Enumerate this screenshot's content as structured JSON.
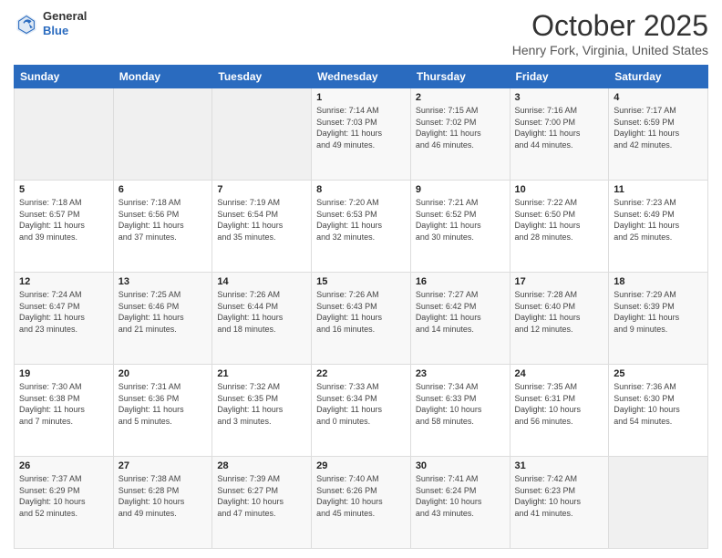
{
  "header": {
    "logo_line1": "General",
    "logo_line2": "Blue",
    "month": "October 2025",
    "location": "Henry Fork, Virginia, United States"
  },
  "days_of_week": [
    "Sunday",
    "Monday",
    "Tuesday",
    "Wednesday",
    "Thursday",
    "Friday",
    "Saturday"
  ],
  "weeks": [
    [
      {
        "day": "",
        "info": ""
      },
      {
        "day": "",
        "info": ""
      },
      {
        "day": "",
        "info": ""
      },
      {
        "day": "1",
        "info": "Sunrise: 7:14 AM\nSunset: 7:03 PM\nDaylight: 11 hours\nand 49 minutes."
      },
      {
        "day": "2",
        "info": "Sunrise: 7:15 AM\nSunset: 7:02 PM\nDaylight: 11 hours\nand 46 minutes."
      },
      {
        "day": "3",
        "info": "Sunrise: 7:16 AM\nSunset: 7:00 PM\nDaylight: 11 hours\nand 44 minutes."
      },
      {
        "day": "4",
        "info": "Sunrise: 7:17 AM\nSunset: 6:59 PM\nDaylight: 11 hours\nand 42 minutes."
      }
    ],
    [
      {
        "day": "5",
        "info": "Sunrise: 7:18 AM\nSunset: 6:57 PM\nDaylight: 11 hours\nand 39 minutes."
      },
      {
        "day": "6",
        "info": "Sunrise: 7:18 AM\nSunset: 6:56 PM\nDaylight: 11 hours\nand 37 minutes."
      },
      {
        "day": "7",
        "info": "Sunrise: 7:19 AM\nSunset: 6:54 PM\nDaylight: 11 hours\nand 35 minutes."
      },
      {
        "day": "8",
        "info": "Sunrise: 7:20 AM\nSunset: 6:53 PM\nDaylight: 11 hours\nand 32 minutes."
      },
      {
        "day": "9",
        "info": "Sunrise: 7:21 AM\nSunset: 6:52 PM\nDaylight: 11 hours\nand 30 minutes."
      },
      {
        "day": "10",
        "info": "Sunrise: 7:22 AM\nSunset: 6:50 PM\nDaylight: 11 hours\nand 28 minutes."
      },
      {
        "day": "11",
        "info": "Sunrise: 7:23 AM\nSunset: 6:49 PM\nDaylight: 11 hours\nand 25 minutes."
      }
    ],
    [
      {
        "day": "12",
        "info": "Sunrise: 7:24 AM\nSunset: 6:47 PM\nDaylight: 11 hours\nand 23 minutes."
      },
      {
        "day": "13",
        "info": "Sunrise: 7:25 AM\nSunset: 6:46 PM\nDaylight: 11 hours\nand 21 minutes."
      },
      {
        "day": "14",
        "info": "Sunrise: 7:26 AM\nSunset: 6:44 PM\nDaylight: 11 hours\nand 18 minutes."
      },
      {
        "day": "15",
        "info": "Sunrise: 7:26 AM\nSunset: 6:43 PM\nDaylight: 11 hours\nand 16 minutes."
      },
      {
        "day": "16",
        "info": "Sunrise: 7:27 AM\nSunset: 6:42 PM\nDaylight: 11 hours\nand 14 minutes."
      },
      {
        "day": "17",
        "info": "Sunrise: 7:28 AM\nSunset: 6:40 PM\nDaylight: 11 hours\nand 12 minutes."
      },
      {
        "day": "18",
        "info": "Sunrise: 7:29 AM\nSunset: 6:39 PM\nDaylight: 11 hours\nand 9 minutes."
      }
    ],
    [
      {
        "day": "19",
        "info": "Sunrise: 7:30 AM\nSunset: 6:38 PM\nDaylight: 11 hours\nand 7 minutes."
      },
      {
        "day": "20",
        "info": "Sunrise: 7:31 AM\nSunset: 6:36 PM\nDaylight: 11 hours\nand 5 minutes."
      },
      {
        "day": "21",
        "info": "Sunrise: 7:32 AM\nSunset: 6:35 PM\nDaylight: 11 hours\nand 3 minutes."
      },
      {
        "day": "22",
        "info": "Sunrise: 7:33 AM\nSunset: 6:34 PM\nDaylight: 11 hours\nand 0 minutes."
      },
      {
        "day": "23",
        "info": "Sunrise: 7:34 AM\nSunset: 6:33 PM\nDaylight: 10 hours\nand 58 minutes."
      },
      {
        "day": "24",
        "info": "Sunrise: 7:35 AM\nSunset: 6:31 PM\nDaylight: 10 hours\nand 56 minutes."
      },
      {
        "day": "25",
        "info": "Sunrise: 7:36 AM\nSunset: 6:30 PM\nDaylight: 10 hours\nand 54 minutes."
      }
    ],
    [
      {
        "day": "26",
        "info": "Sunrise: 7:37 AM\nSunset: 6:29 PM\nDaylight: 10 hours\nand 52 minutes."
      },
      {
        "day": "27",
        "info": "Sunrise: 7:38 AM\nSunset: 6:28 PM\nDaylight: 10 hours\nand 49 minutes."
      },
      {
        "day": "28",
        "info": "Sunrise: 7:39 AM\nSunset: 6:27 PM\nDaylight: 10 hours\nand 47 minutes."
      },
      {
        "day": "29",
        "info": "Sunrise: 7:40 AM\nSunset: 6:26 PM\nDaylight: 10 hours\nand 45 minutes."
      },
      {
        "day": "30",
        "info": "Sunrise: 7:41 AM\nSunset: 6:24 PM\nDaylight: 10 hours\nand 43 minutes."
      },
      {
        "day": "31",
        "info": "Sunrise: 7:42 AM\nSunset: 6:23 PM\nDaylight: 10 hours\nand 41 minutes."
      },
      {
        "day": "",
        "info": ""
      }
    ]
  ]
}
